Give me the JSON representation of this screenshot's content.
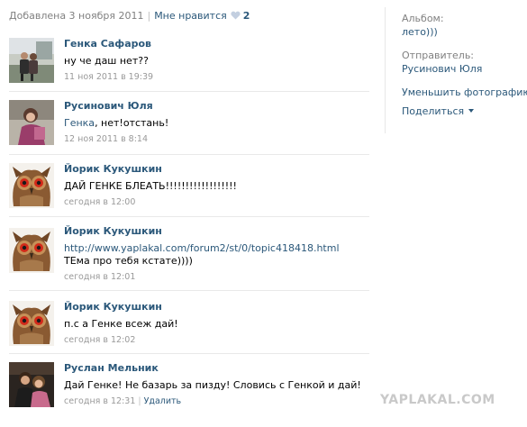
{
  "header": {
    "added": "Добавлена 3 ноября 2011",
    "separator": "|",
    "like_label": "Мне нравится",
    "like_count": "2"
  },
  "comments": [
    {
      "author": "Генка Сафаров",
      "text": "ну че даш нет??",
      "date": "11 ноя 2011 в 19:39",
      "avatar": "photo-two-people"
    },
    {
      "author": "Русинович Юля",
      "reply_to": "Генка",
      "text": ", нет!отстань!",
      "date": "12 ноя 2011 в 8:14",
      "avatar": "photo-girl"
    },
    {
      "author": "Йорик Кукушкин",
      "text": "ДАЙ ГЕНКЕ БЛЕАТЬ!!!!!!!!!!!!!!!!!!",
      "date": "сегодня в 12:00",
      "avatar": "owl-icon"
    },
    {
      "author": "Йорик Кукушкин",
      "link": "http://www.yaplakal.com/forum2/st/0/topic418418.html",
      "text_after": " ТЕма про тебя кстате))))",
      "date": "сегодня в 12:01",
      "avatar": "owl-icon"
    },
    {
      "author": "Йорик Кукушкин",
      "text": "п.с а Генке всеж дай!",
      "date": "сегодня в 12:02",
      "avatar": "owl-icon"
    },
    {
      "author": "Руслан Мельник",
      "text": "Дай Генке! Не базарь за пизду! Словись с Генкой и дай!",
      "date": "сегодня в 12:31",
      "delete_label": "Удалить",
      "avatar": "photo-couple"
    }
  ],
  "sidebar": {
    "album_label": "Альбом:",
    "album_value": "лето)))",
    "sender_label": "Отправитель:",
    "sender_value": "Русинович Юля",
    "reduce_label": "Уменьшить фотографию",
    "share_label": "Поделиться"
  },
  "watermark": "YAPLAKAL.COM",
  "colors": {
    "link": "#2b587a",
    "muted": "#808080",
    "date": "#999999",
    "heart": "#c3cfe0",
    "watermark": "#c9c9c9"
  }
}
